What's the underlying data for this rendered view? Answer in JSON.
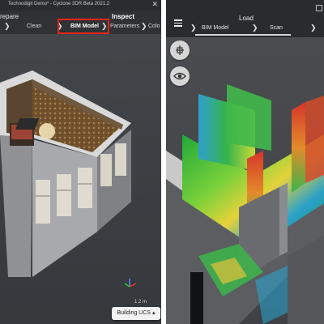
{
  "left_app": {
    "window_title": "Technodigit Demo* - Cyclone 3DR Beta 2021.2",
    "close_glyph": "✕",
    "stages": {
      "prepare": "repare",
      "inspect": "Inspect"
    },
    "steps": {
      "clean": "Clean",
      "bim_model": "BIM Model",
      "parameters": "Parameters",
      "truncated": "Colo"
    },
    "selected_step": "BIM Model",
    "chevron": "❯",
    "ucs_button": "Building UCS",
    "ucs_caret": "▴",
    "scale_text": "1.2 m",
    "highlight_color": "#e1251b"
  },
  "right_app": {
    "header_title": "Load",
    "steps": {
      "bim_model": "BIM Model",
      "scan": "Scan"
    },
    "chevron": "❯",
    "tool_buttons": [
      {
        "icon": "fit-to-view-icon"
      },
      {
        "icon": "eye-icon"
      }
    ]
  }
}
